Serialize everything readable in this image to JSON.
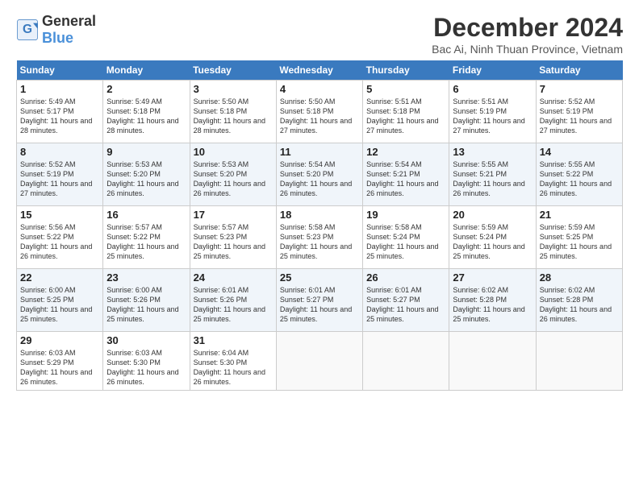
{
  "header": {
    "logo_general": "General",
    "logo_blue": "Blue",
    "month_title": "December 2024",
    "location": "Bac Ai, Ninh Thuan Province, Vietnam"
  },
  "weekdays": [
    "Sunday",
    "Monday",
    "Tuesday",
    "Wednesday",
    "Thursday",
    "Friday",
    "Saturday"
  ],
  "weeks": [
    [
      {
        "day": "1",
        "sunrise": "5:49 AM",
        "sunset": "5:17 PM",
        "daylight": "11 hours and 28 minutes."
      },
      {
        "day": "2",
        "sunrise": "5:49 AM",
        "sunset": "5:18 PM",
        "daylight": "11 hours and 28 minutes."
      },
      {
        "day": "3",
        "sunrise": "5:50 AM",
        "sunset": "5:18 PM",
        "daylight": "11 hours and 28 minutes."
      },
      {
        "day": "4",
        "sunrise": "5:50 AM",
        "sunset": "5:18 PM",
        "daylight": "11 hours and 27 minutes."
      },
      {
        "day": "5",
        "sunrise": "5:51 AM",
        "sunset": "5:18 PM",
        "daylight": "11 hours and 27 minutes."
      },
      {
        "day": "6",
        "sunrise": "5:51 AM",
        "sunset": "5:19 PM",
        "daylight": "11 hours and 27 minutes."
      },
      {
        "day": "7",
        "sunrise": "5:52 AM",
        "sunset": "5:19 PM",
        "daylight": "11 hours and 27 minutes."
      }
    ],
    [
      {
        "day": "8",
        "sunrise": "5:52 AM",
        "sunset": "5:19 PM",
        "daylight": "11 hours and 27 minutes."
      },
      {
        "day": "9",
        "sunrise": "5:53 AM",
        "sunset": "5:20 PM",
        "daylight": "11 hours and 26 minutes."
      },
      {
        "day": "10",
        "sunrise": "5:53 AM",
        "sunset": "5:20 PM",
        "daylight": "11 hours and 26 minutes."
      },
      {
        "day": "11",
        "sunrise": "5:54 AM",
        "sunset": "5:20 PM",
        "daylight": "11 hours and 26 minutes."
      },
      {
        "day": "12",
        "sunrise": "5:54 AM",
        "sunset": "5:21 PM",
        "daylight": "11 hours and 26 minutes."
      },
      {
        "day": "13",
        "sunrise": "5:55 AM",
        "sunset": "5:21 PM",
        "daylight": "11 hours and 26 minutes."
      },
      {
        "day": "14",
        "sunrise": "5:55 AM",
        "sunset": "5:22 PM",
        "daylight": "11 hours and 26 minutes."
      }
    ],
    [
      {
        "day": "15",
        "sunrise": "5:56 AM",
        "sunset": "5:22 PM",
        "daylight": "11 hours and 26 minutes."
      },
      {
        "day": "16",
        "sunrise": "5:57 AM",
        "sunset": "5:22 PM",
        "daylight": "11 hours and 25 minutes."
      },
      {
        "day": "17",
        "sunrise": "5:57 AM",
        "sunset": "5:23 PM",
        "daylight": "11 hours and 25 minutes."
      },
      {
        "day": "18",
        "sunrise": "5:58 AM",
        "sunset": "5:23 PM",
        "daylight": "11 hours and 25 minutes."
      },
      {
        "day": "19",
        "sunrise": "5:58 AM",
        "sunset": "5:24 PM",
        "daylight": "11 hours and 25 minutes."
      },
      {
        "day": "20",
        "sunrise": "5:59 AM",
        "sunset": "5:24 PM",
        "daylight": "11 hours and 25 minutes."
      },
      {
        "day": "21",
        "sunrise": "5:59 AM",
        "sunset": "5:25 PM",
        "daylight": "11 hours and 25 minutes."
      }
    ],
    [
      {
        "day": "22",
        "sunrise": "6:00 AM",
        "sunset": "5:25 PM",
        "daylight": "11 hours and 25 minutes."
      },
      {
        "day": "23",
        "sunrise": "6:00 AM",
        "sunset": "5:26 PM",
        "daylight": "11 hours and 25 minutes."
      },
      {
        "day": "24",
        "sunrise": "6:01 AM",
        "sunset": "5:26 PM",
        "daylight": "11 hours and 25 minutes."
      },
      {
        "day": "25",
        "sunrise": "6:01 AM",
        "sunset": "5:27 PM",
        "daylight": "11 hours and 25 minutes."
      },
      {
        "day": "26",
        "sunrise": "6:01 AM",
        "sunset": "5:27 PM",
        "daylight": "11 hours and 25 minutes."
      },
      {
        "day": "27",
        "sunrise": "6:02 AM",
        "sunset": "5:28 PM",
        "daylight": "11 hours and 25 minutes."
      },
      {
        "day": "28",
        "sunrise": "6:02 AM",
        "sunset": "5:28 PM",
        "daylight": "11 hours and 26 minutes."
      }
    ],
    [
      {
        "day": "29",
        "sunrise": "6:03 AM",
        "sunset": "5:29 PM",
        "daylight": "11 hours and 26 minutes."
      },
      {
        "day": "30",
        "sunrise": "6:03 AM",
        "sunset": "5:30 PM",
        "daylight": "11 hours and 26 minutes."
      },
      {
        "day": "31",
        "sunrise": "6:04 AM",
        "sunset": "5:30 PM",
        "daylight": "11 hours and 26 minutes."
      },
      null,
      null,
      null,
      null
    ]
  ]
}
